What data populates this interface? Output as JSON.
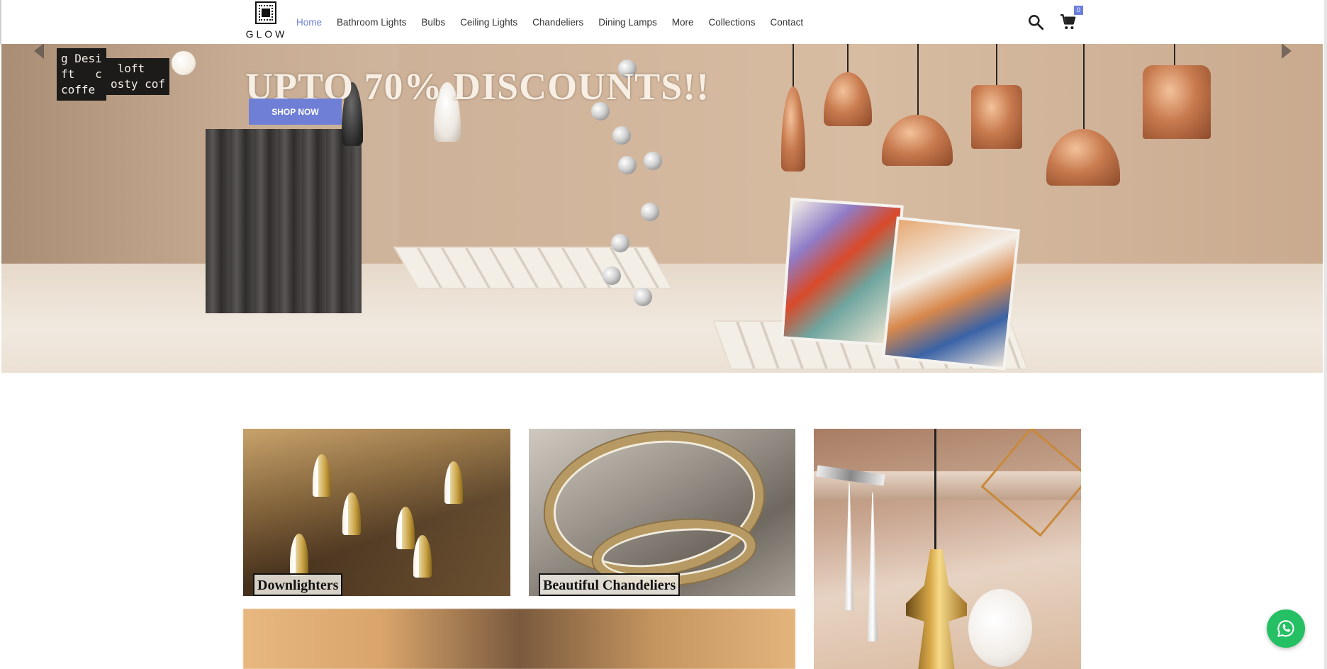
{
  "brand": {
    "logo_text": "GLOW"
  },
  "nav": {
    "items": [
      {
        "label": "Home",
        "active": true
      },
      {
        "label": "Bathroom Lights",
        "active": false
      },
      {
        "label": "Bulbs",
        "active": false
      },
      {
        "label": "Ceiling Lights",
        "active": false
      },
      {
        "label": "Chandeliers",
        "active": false
      },
      {
        "label": "Dining Lamps",
        "active": false
      },
      {
        "label": "More",
        "active": false
      },
      {
        "label": "Collections",
        "active": false
      },
      {
        "label": "Contact",
        "active": false
      }
    ]
  },
  "header_icons": {
    "search": "search-icon",
    "cart": "cart-icon",
    "cart_count": "0"
  },
  "hero": {
    "title": "UPTO 70% DISCOUNTS!!",
    "cta_label": "SHOP NOW",
    "signs": [
      "g Desi\nft   c\ncoffe",
      " loft\nosty cof"
    ]
  },
  "collections": [
    {
      "label": "Downlighters"
    },
    {
      "label": "Beautiful Chandeliers"
    }
  ],
  "whatsapp": {
    "icon": "whatsapp-icon"
  },
  "colors": {
    "accent": "#6b7fdc",
    "cta": "#6f7fd6",
    "whatsapp": "#25c063"
  }
}
